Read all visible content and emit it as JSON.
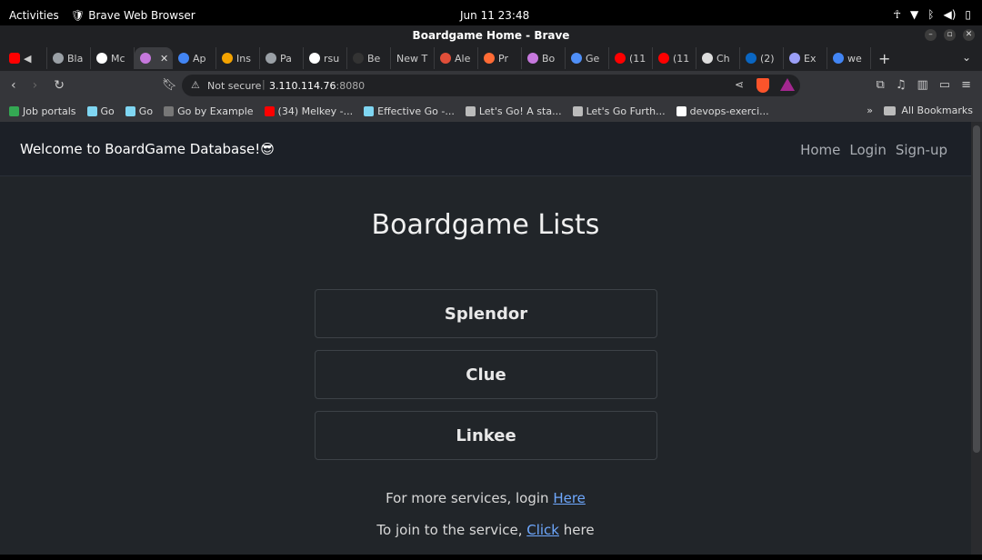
{
  "system_bar": {
    "activities": "Activities",
    "app_name": "Brave Web Browser",
    "clock": "Jun 11  23:48"
  },
  "window": {
    "title": "Boardgame Home - Brave"
  },
  "tabs": [
    {
      "label": "Bla",
      "icon": "globe-icon",
      "color": "#9aa0a6"
    },
    {
      "label": "Mc",
      "icon": "github-icon",
      "color": "#ffffff"
    },
    {
      "label": "",
      "icon": "tab-icon",
      "color": "#c678dd",
      "active": true
    },
    {
      "label": "Ap",
      "icon": "google-icon",
      "color": "#4285f4"
    },
    {
      "label": "Ins",
      "icon": "page-icon",
      "color": "#f4a300"
    },
    {
      "label": "Pa",
      "icon": "link-icon",
      "color": "#9aa0a6"
    },
    {
      "label": "rsu",
      "icon": "github-icon",
      "color": "#ffffff"
    },
    {
      "label": "Be",
      "icon": "page-icon",
      "color": "#333333"
    },
    {
      "label": "New T",
      "icon": "",
      "color": ""
    },
    {
      "label": "Ale",
      "icon": "page-icon",
      "color": "#e04e39"
    },
    {
      "label": "Pr",
      "icon": "page-icon",
      "color": "#ff6b35"
    },
    {
      "label": "Bo",
      "icon": "page-icon",
      "color": "#c678dd"
    },
    {
      "label": "Ge",
      "icon": "gemini-icon",
      "color": "#4f8ff7"
    },
    {
      "label": "(11",
      "icon": "youtube-icon",
      "color": "#ff0000"
    },
    {
      "label": "(11",
      "icon": "youtube-icon",
      "color": "#ff0000"
    },
    {
      "label": "Ch",
      "icon": "chatgpt-icon",
      "color": "#dddddd"
    },
    {
      "label": "(2)",
      "icon": "linkedin-icon",
      "color": "#0a66c2"
    },
    {
      "label": "Ex",
      "icon": "page-icon",
      "color": "#9b9ff7"
    },
    {
      "label": "we",
      "icon": "google-icon",
      "color": "#4285f4"
    }
  ],
  "toolbar": {
    "security_label": "Not secure",
    "url_host": "3.110.114.76",
    "url_port": ":8080"
  },
  "bookmarks": [
    {
      "label": "Job portals",
      "color": "#34a853"
    },
    {
      "label": "Go",
      "color": "#7fd6f2"
    },
    {
      "label": "Go",
      "color": "#7fd6f2"
    },
    {
      "label": "Go by Example",
      "color": "#777777"
    },
    {
      "label": "(34) Melkey -...",
      "color": "#ff0000"
    },
    {
      "label": "Effective Go -...",
      "color": "#7fd6f2"
    },
    {
      "label": "Let's Go! A sta...",
      "color": "#bbbbbb"
    },
    {
      "label": "Let's Go Furth...",
      "color": "#bbbbbb"
    },
    {
      "label": "devops-exerci...",
      "color": "#ffffff"
    }
  ],
  "bookmarks_more": "»",
  "all_bookmarks": "All Bookmarks",
  "site": {
    "brand": "Welcome to BoardGame Database!😎",
    "nav": {
      "home": "Home",
      "login": "Login",
      "signup": "Sign-up"
    },
    "heading": "Boardgame Lists",
    "games": [
      "Splendor",
      "Clue",
      "Linkee"
    ],
    "footer1_text": "For more services, login ",
    "footer1_link": "Here",
    "footer2_text": "To join to the service, ",
    "footer2_link": "Click",
    "footer2_after": " here"
  }
}
